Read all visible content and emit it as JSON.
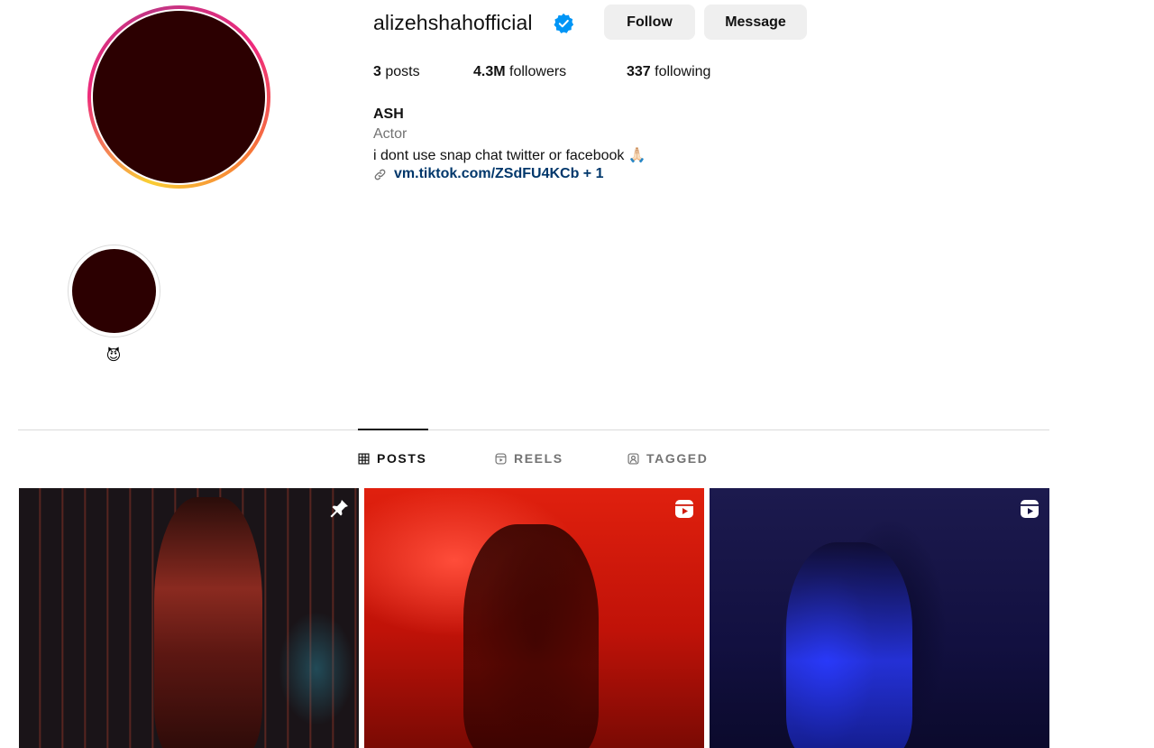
{
  "profile": {
    "username": "alizehshahofficial",
    "verified": true,
    "follow_label": "Follow",
    "message_label": "Message",
    "stats": {
      "posts_count": "3",
      "posts_label": "posts",
      "followers_count": "4.3M",
      "followers_label": "followers",
      "following_count": "337",
      "following_label": "following"
    },
    "bio": {
      "name": "ASH",
      "category": "Actor",
      "text": "i dont use snap chat twitter or facebook 🙏🏻",
      "link": "vm.tiktok.com/ZSdFU4KCb + 1"
    }
  },
  "highlights": [
    {
      "label": "😈"
    }
  ],
  "tabs": [
    {
      "label": "POSTS",
      "active": true
    },
    {
      "label": "REELS",
      "active": false
    },
    {
      "label": "TAGGED",
      "active": false
    }
  ],
  "posts": [
    {
      "badge": "pin-icon",
      "dominant_color": "#1b1517"
    },
    {
      "badge": "reel-icon",
      "dominant_color": "#d01a0c"
    },
    {
      "badge": "reel-icon",
      "dominant_color": "#141244"
    }
  ],
  "colors": {
    "verified_blue": "#0095f6",
    "link_blue": "#00376b",
    "button_bg": "#efefef",
    "muted_text": "#737373"
  }
}
